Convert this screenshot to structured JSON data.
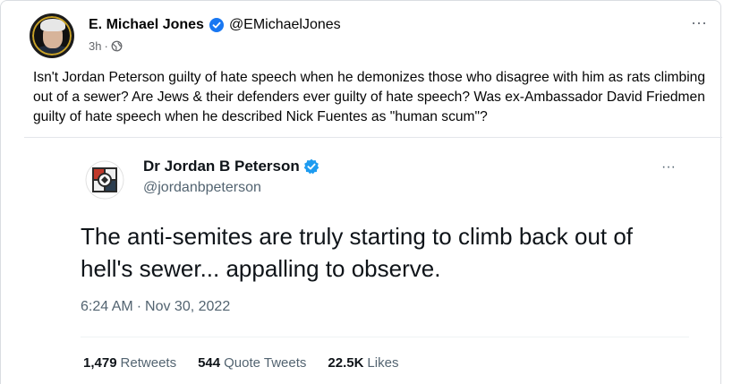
{
  "post": {
    "author_name": "E. Michael Jones",
    "handle": "@EMichaelJones",
    "time": "3h",
    "separator": "·",
    "text": "Isn't Jordan Peterson guilty of hate speech when he demonizes those who disagree with him as rats climbing out of a sewer? Are Jews & their defenders ever guilty of hate speech? Was ex-Ambassador David Friedmen guilty of hate speech when he described Nick Fuentes as \"human scum\"?",
    "more_label": "···",
    "icons": {
      "verified": "verified-badge-icon",
      "audience": "globe-icon",
      "more": "more-horizontal-icon"
    },
    "colors": {
      "verified_blue": "#1877f2",
      "meta_gray": "#65676b"
    }
  },
  "tweet": {
    "name": "Dr Jordan B Peterson",
    "handle": "@jordanbpeterson",
    "more_label": "···",
    "body": "The anti-semites are truly starting to climb back out of hell's sewer... appalling to observe.",
    "time": "6:24 AM",
    "separator": "·",
    "date": "Nov 30, 2022",
    "stats": {
      "retweets_count": "1,479",
      "retweets_label": "Retweets",
      "quotes_count": "544",
      "quotes_label": "Quote Tweets",
      "likes_count": "22.5K",
      "likes_label": "Likes"
    },
    "colors": {
      "verified_blue": "#1d9bf0",
      "secondary_text": "#536471"
    }
  }
}
